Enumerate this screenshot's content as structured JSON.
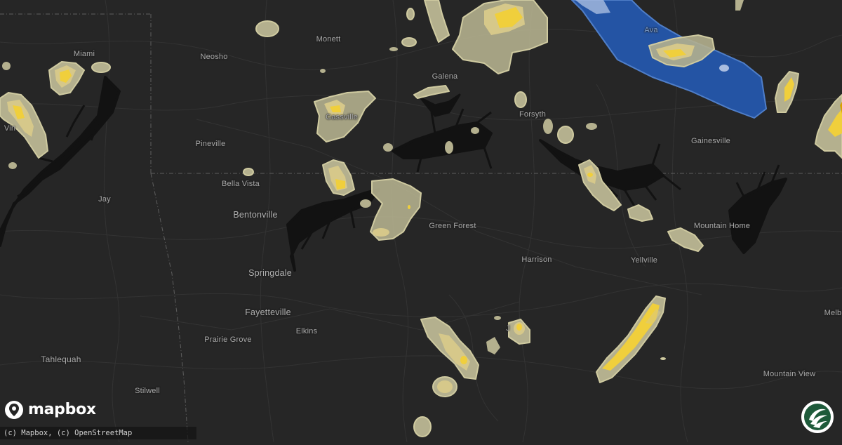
{
  "map": {
    "colors": {
      "background": "#262626",
      "water": "#121212",
      "border": "#5e5e5e",
      "hail_low": "#b4b08e",
      "hail_mid": "#d6c88a",
      "hail_high": "#f0cf3c",
      "hail_top": "#d9a000",
      "warning_blue": "#2454a4",
      "warning_light": "#a9bde0",
      "badge_green": "#1e5a3a"
    },
    "cities": [
      {
        "id": "miami",
        "name": "Miami"
      },
      {
        "id": "neosho",
        "name": "Neosho"
      },
      {
        "id": "monett",
        "name": "Monett"
      },
      {
        "id": "galena",
        "name": "Galena"
      },
      {
        "id": "ava",
        "name": "Ava"
      },
      {
        "id": "vinita",
        "name": "Vin"
      },
      {
        "id": "cassville",
        "name": "Cassville"
      },
      {
        "id": "forsyth",
        "name": "Forsyth"
      },
      {
        "id": "gainesville",
        "name": "Gainesville"
      },
      {
        "id": "pineville",
        "name": "Pineville"
      },
      {
        "id": "bella-vista",
        "name": "Bella Vista"
      },
      {
        "id": "jay",
        "name": "Jay"
      },
      {
        "id": "bentonville",
        "name": "Bentonville"
      },
      {
        "id": "green-forest",
        "name": "Green Forest"
      },
      {
        "id": "mountain-home",
        "name": "Mountain Home"
      },
      {
        "id": "springdale",
        "name": "Springdale"
      },
      {
        "id": "harrison",
        "name": "Harrison"
      },
      {
        "id": "yellville",
        "name": "Yellville"
      },
      {
        "id": "fayetteville",
        "name": "Fayetteville"
      },
      {
        "id": "melbourne",
        "name": "Melb"
      },
      {
        "id": "elkins",
        "name": "Elkins"
      },
      {
        "id": "jasper",
        "name": "J"
      },
      {
        "id": "prairie-grove",
        "name": "Prairie Grove"
      },
      {
        "id": "tahlequah",
        "name": "Tahlequah"
      },
      {
        "id": "mountain-view",
        "name": "Mountain View"
      },
      {
        "id": "stilwell",
        "name": "Stilwell"
      }
    ]
  },
  "branding": {
    "logo_text": "mapbox",
    "attribution": "(c) Mapbox, (c) OpenStreetMap"
  }
}
